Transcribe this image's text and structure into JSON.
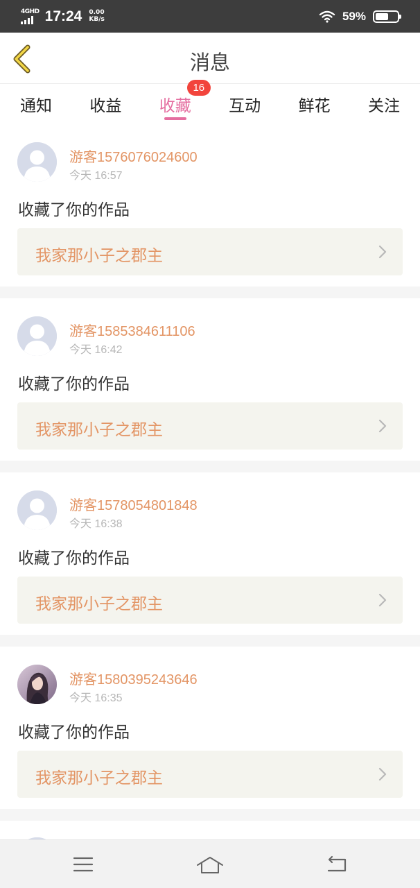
{
  "status_bar": {
    "network": "4GHD",
    "time": "17:24",
    "speed_value": "0.00",
    "speed_unit": "KB/s",
    "battery_percent": "59%",
    "battery_level": 0.59
  },
  "header": {
    "title": "消息",
    "back_icon": "chevron-left-icon"
  },
  "tabs": [
    {
      "label": "通知"
    },
    {
      "label": "收益"
    },
    {
      "label": "收藏",
      "active": true,
      "badge": "16"
    },
    {
      "label": "互动"
    },
    {
      "label": "鲜花"
    },
    {
      "label": "关注"
    }
  ],
  "colors": {
    "accent": "#e56ea0",
    "name": "#e39565",
    "badge": "#f2443c",
    "card_bg": "#f4f4ee"
  },
  "messages": [
    {
      "user": "游客1576076024600",
      "time": "今天 16:57",
      "action": "收藏了你的作品",
      "work_title": "我家那小子之郡主",
      "avatar": "default-avatar"
    },
    {
      "user": "游客1585384611106",
      "time": "今天 16:42",
      "action": "收藏了你的作品",
      "work_title": "我家那小子之郡主",
      "avatar": "default-avatar"
    },
    {
      "user": "游客1578054801848",
      "time": "今天 16:38",
      "action": "收藏了你的作品",
      "work_title": "我家那小子之郡主",
      "avatar": "default-avatar"
    },
    {
      "user": "游客1580395243646",
      "time": "今天 16:35",
      "action": "收藏了你的作品",
      "work_title": "我家那小子之郡主",
      "avatar": "photo-avatar"
    }
  ],
  "nav_bar": {
    "menu_icon": "menu-icon",
    "home_icon": "home-icon",
    "back_icon": "back-arrow-icon"
  }
}
